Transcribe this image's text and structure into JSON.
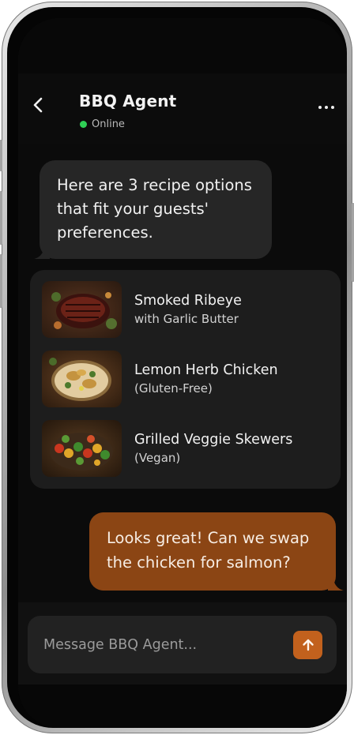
{
  "header": {
    "agent_name": "BBQ Agent",
    "status": "Online",
    "status_color": "#2fcf55"
  },
  "icons": {
    "back": "chevron-left-icon",
    "more": "more-horizontal-icon",
    "send": "arrow-up-icon"
  },
  "messages": {
    "agent_intro": "Here are 3 recipe options that fit your guests' preferences.",
    "user_reply": "Looks great! Can we swap the chicken for salmon?"
  },
  "recipes": [
    {
      "title": "Smoked Ribeye",
      "subtitle": "with Garlic Butter"
    },
    {
      "title": "Lemon Herb Chicken",
      "subtitle": "(Gluten-Free)"
    },
    {
      "title": "Grilled Veggie Skewers",
      "subtitle": "(Vegan)"
    }
  ],
  "composer": {
    "placeholder": "Message BBQ Agent..."
  },
  "colors": {
    "accent": "#c2611d",
    "user_bubble": "#8b4514",
    "agent_bubble": "#262626",
    "background": "#0b0b0b"
  }
}
